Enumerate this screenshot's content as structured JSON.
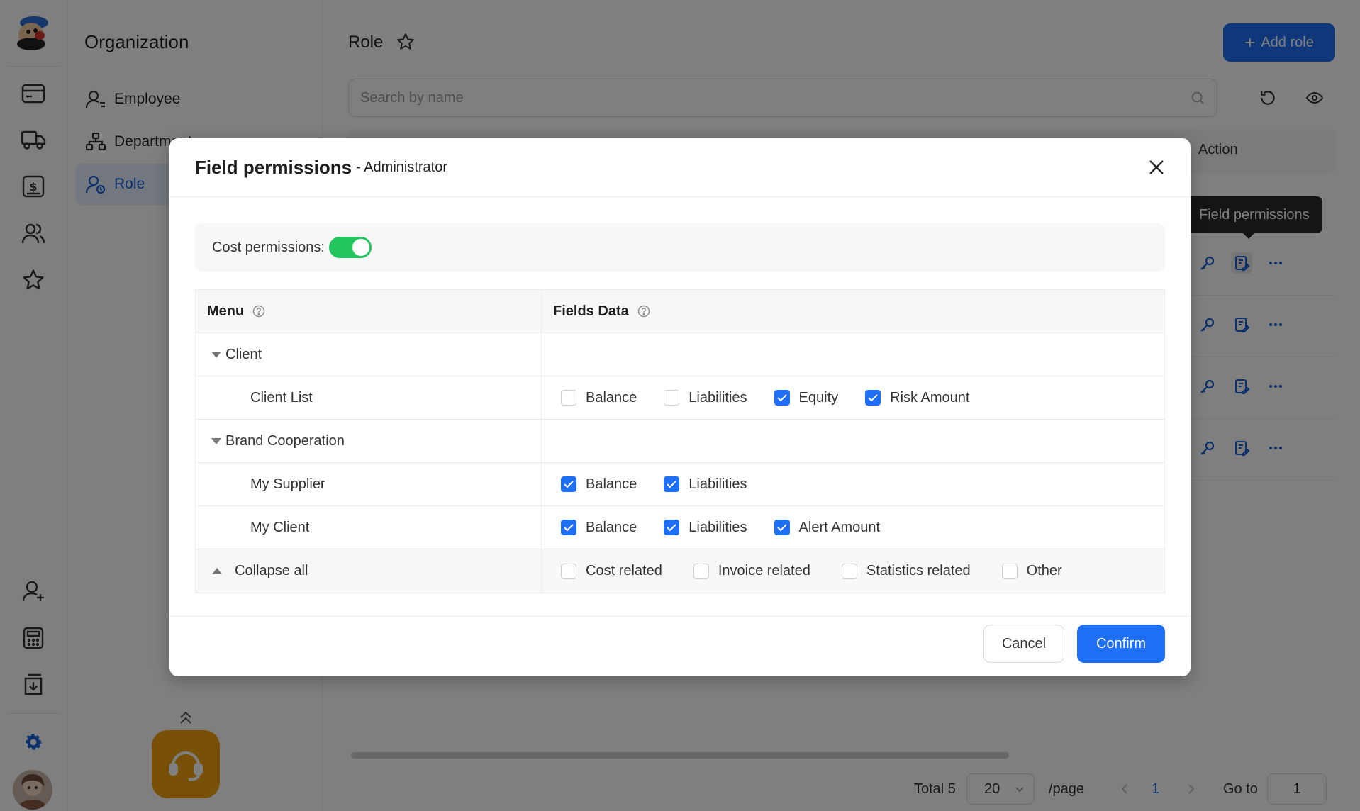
{
  "sidebar": {
    "title": "Organization",
    "items": [
      {
        "label": "Employee",
        "icon": "user-icon"
      },
      {
        "label": "Department",
        "icon": "org-chart-icon"
      },
      {
        "label": "Role",
        "icon": "role-icon",
        "active": true
      }
    ]
  },
  "main": {
    "title": "Role",
    "add_button": "Add role",
    "search_placeholder": "Search by name",
    "action_header": "Action",
    "tooltip": "Field permissions"
  },
  "pagination": {
    "total": "Total 5",
    "page_size": "20",
    "per_page": "/page",
    "current": "1",
    "goto_label": "Go to",
    "goto_value": "1"
  },
  "modal": {
    "title": "Field permissions",
    "subtitle": "- Administrator",
    "cost_label": "Cost permissions:",
    "cost_enabled": true,
    "col_menu": "Menu",
    "col_fields": "Fields Data",
    "groups": {
      "client": "Client",
      "client_list": "Client List",
      "brand": "Brand Cooperation",
      "my_supplier": "My Supplier",
      "my_client": "My Client",
      "collapse_all": "Collapse all"
    },
    "client_list_fields": [
      {
        "label": "Balance",
        "checked": false
      },
      {
        "label": "Liabilities",
        "checked": false
      },
      {
        "label": "Equity",
        "checked": true
      },
      {
        "label": "Risk Amount",
        "checked": true
      }
    ],
    "my_supplier_fields": [
      {
        "label": "Balance",
        "checked": true
      },
      {
        "label": "Liabilities",
        "checked": true
      }
    ],
    "my_client_fields": [
      {
        "label": "Balance",
        "checked": true
      },
      {
        "label": "Liabilities",
        "checked": true
      },
      {
        "label": "Alert Amount",
        "checked": true
      }
    ],
    "footer_fields": [
      {
        "label": "Cost related",
        "checked": false
      },
      {
        "label": "Invoice related",
        "checked": false
      },
      {
        "label": "Statistics related",
        "checked": false
      },
      {
        "label": "Other",
        "checked": false
      }
    ],
    "cancel": "Cancel",
    "confirm": "Confirm"
  },
  "colors": {
    "primary": "#1e6ff5",
    "switch_on": "#22c55e",
    "support": "#f0a010"
  }
}
